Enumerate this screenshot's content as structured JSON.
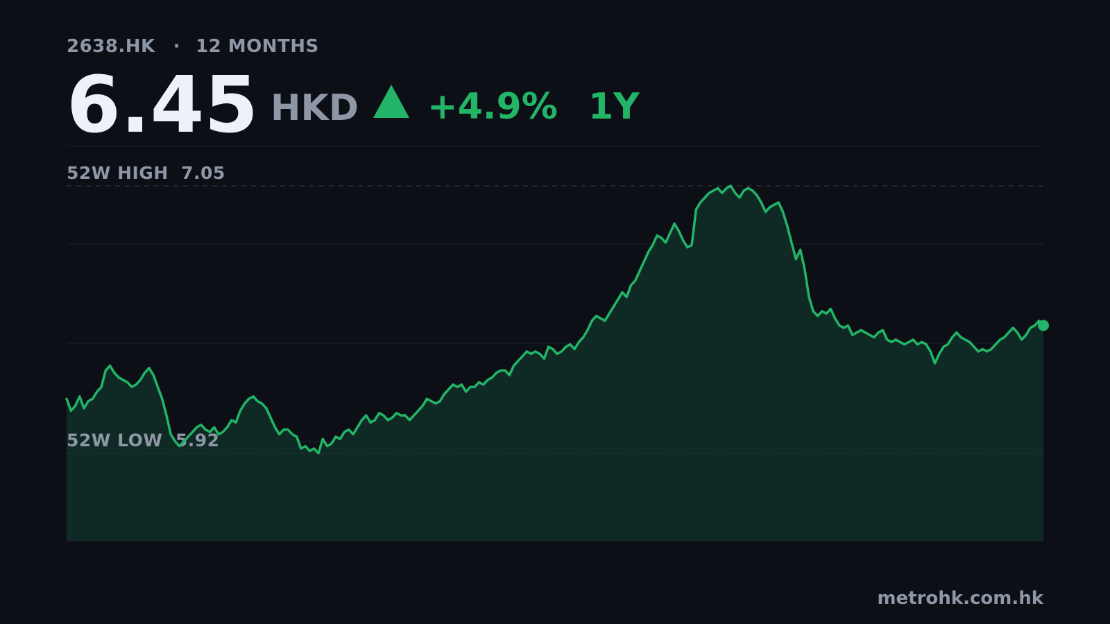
{
  "header": {
    "ticker": "2638.HK",
    "separator": "·",
    "range_label": "12 MONTHS",
    "price": "6.45",
    "currency": "HKD",
    "direction_icon": "triangle-up-icon",
    "change": "+4.9%",
    "period": "1Y"
  },
  "footer": {
    "source": "metrohk.com.hk"
  },
  "colors": {
    "background": "#0c0f16",
    "accent": "#22b567",
    "area_fill": "#0f2a24",
    "muted": "#8e97a6",
    "gridline": "#1f2430"
  },
  "chart_data": {
    "type": "area",
    "ylim": [
      5.55,
      7.22
    ],
    "grid": true,
    "series": [
      {
        "values": [
          6.15,
          6.1,
          6.12,
          6.16,
          6.11,
          6.14,
          6.15,
          6.18,
          6.2,
          6.27,
          6.29,
          6.26,
          6.24,
          6.23,
          6.22,
          6.2,
          6.21,
          6.23,
          6.26,
          6.28,
          6.25,
          6.2,
          6.15,
          6.08,
          6.0,
          5.97,
          5.95,
          5.97,
          5.99,
          6.01,
          6.03,
          6.04,
          6.02,
          6.01,
          6.03,
          6.0,
          6.01,
          6.03,
          6.06,
          6.05,
          6.1,
          6.13,
          6.15,
          6.16,
          6.14,
          6.13,
          6.11,
          6.07,
          6.03,
          6.0,
          6.02,
          6.02,
          6.0,
          5.99,
          5.94,
          5.95,
          5.93,
          5.94,
          5.92,
          5.98,
          5.95,
          5.96,
          5.99,
          5.98,
          6.01,
          6.02,
          6.0,
          6.03,
          6.06,
          6.08,
          6.05,
          6.06,
          6.09,
          6.08,
          6.06,
          6.07,
          6.09,
          6.08,
          6.08,
          6.06,
          6.08,
          6.1,
          6.12,
          6.15,
          6.14,
          6.13,
          6.14,
          6.17,
          6.19,
          6.21,
          6.2,
          6.21,
          6.18,
          6.2,
          6.2,
          6.22,
          6.21,
          6.23,
          6.24,
          6.26,
          6.27,
          6.27,
          6.25,
          6.29,
          6.31,
          6.33,
          6.35,
          6.34,
          6.35,
          6.34,
          6.32,
          6.37,
          6.36,
          6.34,
          6.35,
          6.37,
          6.38,
          6.36,
          6.39,
          6.41,
          6.44,
          6.48,
          6.5,
          6.49,
          6.48,
          6.51,
          6.54,
          6.57,
          6.6,
          6.58,
          6.63,
          6.65,
          6.69,
          6.73,
          6.77,
          6.8,
          6.84,
          6.83,
          6.81,
          6.85,
          6.89,
          6.86,
          6.82,
          6.79,
          6.8,
          6.95,
          6.98,
          7.0,
          7.02,
          7.03,
          7.04,
          7.02,
          7.04,
          7.05,
          7.02,
          7.0,
          7.03,
          7.04,
          7.03,
          7.01,
          6.98,
          6.94,
          6.96,
          6.97,
          6.98,
          6.94,
          6.88,
          6.81,
          6.74,
          6.78,
          6.7,
          6.58,
          6.52,
          6.5,
          6.52,
          6.51,
          6.53,
          6.49,
          6.46,
          6.45,
          6.46,
          6.42,
          6.43,
          6.44,
          6.43,
          6.42,
          6.41,
          6.43,
          6.44,
          6.4,
          6.39,
          6.4,
          6.39,
          6.38,
          6.39,
          6.4,
          6.38,
          6.39,
          6.38,
          6.35,
          6.3,
          6.34,
          6.37,
          6.38,
          6.41,
          6.43,
          6.41,
          6.4,
          6.39,
          6.37,
          6.35,
          6.36,
          6.35,
          6.36,
          6.38,
          6.4,
          6.41,
          6.43,
          6.45,
          6.43,
          6.4,
          6.42,
          6.45,
          6.46,
          6.48,
          6.46
        ]
      }
    ],
    "annotations": [
      {
        "label": "52W HIGH",
        "value": 7.05
      },
      {
        "label": "52W LOW",
        "value": 5.92
      }
    ],
    "reference_texts": {
      "high": "52W HIGH  7.05",
      "low": "52W LOW  5.92"
    }
  }
}
